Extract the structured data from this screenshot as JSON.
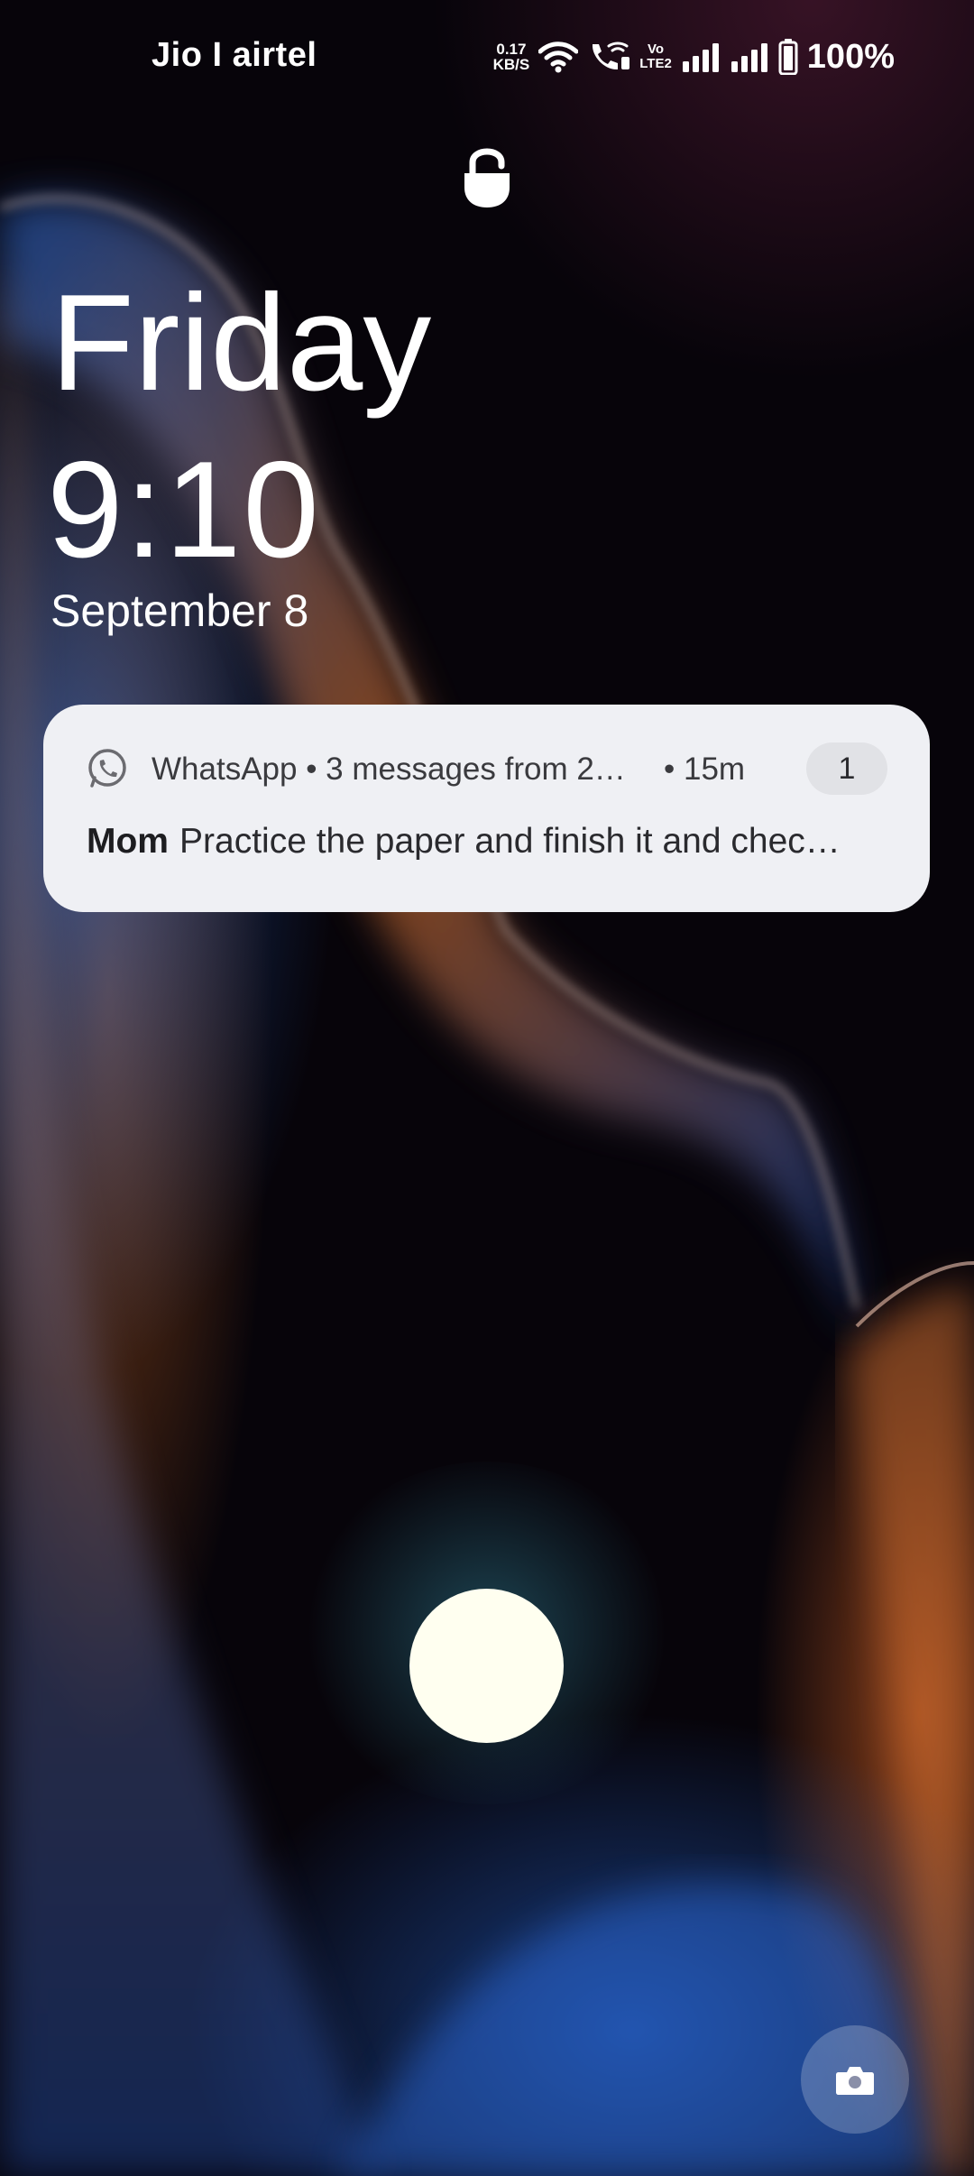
{
  "status_bar": {
    "carrier": "Jio I airtel",
    "network_speed_value": "0.17",
    "network_speed_unit": "KB/S",
    "volte_top": "Vo",
    "volte_bottom": "LTE2",
    "battery": "100%",
    "icons": [
      "wifi-icon",
      "wifi-calling-icon",
      "volte-icon",
      "signal-sim1-icon",
      "signal-sim2-icon",
      "battery-icon"
    ]
  },
  "lock": {
    "icon": "padlock-icon"
  },
  "clock": {
    "day": "Friday",
    "time": "9:10",
    "date": "September 8"
  },
  "notification": {
    "app_icon": "whatsapp-icon",
    "header": "WhatsApp • 3 messages from 2…",
    "time": "• 15m",
    "count": "1",
    "sender": "Mom",
    "message": "Practice the paper and finish it and chec…"
  },
  "fingerprint": {
    "color": "#fffff0"
  },
  "camera": {
    "icon": "camera-icon"
  }
}
